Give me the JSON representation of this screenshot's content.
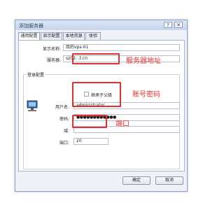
{
  "window": {
    "title": "添加服务器",
    "help_glyph": "?",
    "close_glyph": "✕"
  },
  "tabs": [
    {
      "label": "通用配置"
    },
    {
      "label": "显示配置"
    },
    {
      "label": "本地资源"
    },
    {
      "label": "体验"
    }
  ],
  "general": {
    "display_name_label": "显示名称:",
    "display_name_value": "我的vps-01",
    "server_label": "服务器:",
    "server_value": "sz02.          .t.cn"
  },
  "login": {
    "group_title": "登录配置",
    "inherit_label": "继承于父级",
    "username_label": "用户名:",
    "username_value": "administrator",
    "password_label": "密码:",
    "password_value": "●●●●●●●●●●●●",
    "domain_label": "域:",
    "domain_value": "",
    "port_label": "端口:",
    "port_value": "20"
  },
  "annotations": {
    "server_address": "服务器地址",
    "account_password": "账号密码",
    "port": "端口",
    "color": "#e0302c"
  },
  "buttons": {
    "ok": "确定",
    "cancel": "取消"
  },
  "icons": {
    "computer": "computer-icon"
  }
}
